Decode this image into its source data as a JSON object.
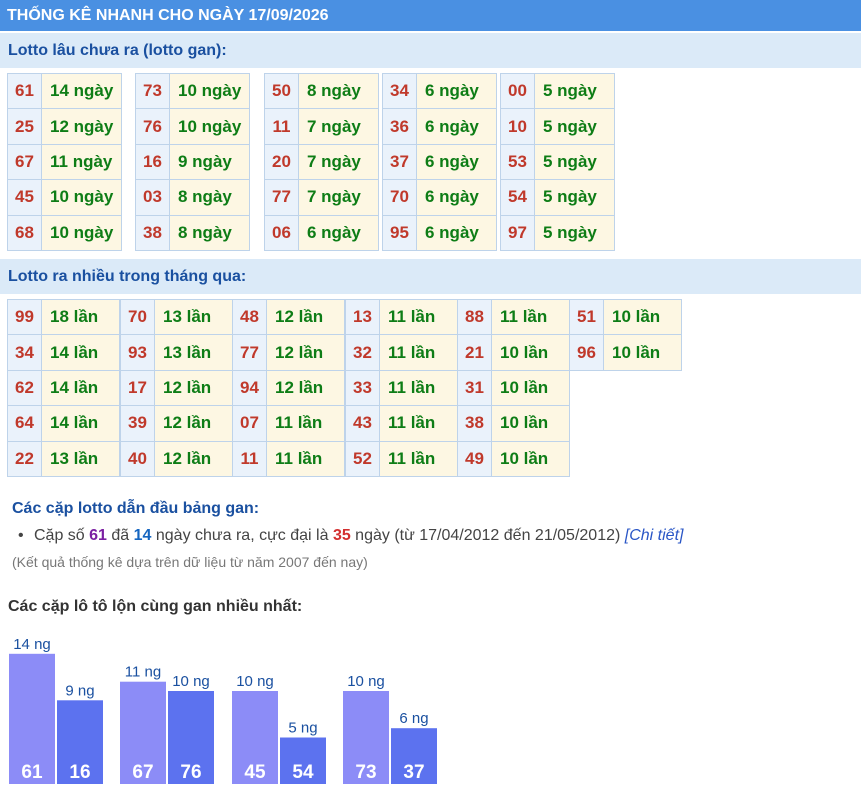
{
  "header": {
    "title": "THỐNG KÊ NHANH CHO NGÀY 17/09/2026"
  },
  "gan_section": {
    "title": "Lotto lâu chưa ra (lotto gan):",
    "columns": [
      [
        {
          "num": "61",
          "val": "14 ngày"
        },
        {
          "num": "25",
          "val": "12 ngày"
        },
        {
          "num": "67",
          "val": "11 ngày"
        },
        {
          "num": "45",
          "val": "10 ngày"
        },
        {
          "num": "68",
          "val": "10 ngày"
        }
      ],
      [
        {
          "num": "73",
          "val": "10 ngày"
        },
        {
          "num": "76",
          "val": "10 ngày"
        },
        {
          "num": "16",
          "val": "9 ngày"
        },
        {
          "num": "03",
          "val": "8 ngày"
        },
        {
          "num": "38",
          "val": "8 ngày"
        }
      ],
      [
        {
          "num": "50",
          "val": "8 ngày"
        },
        {
          "num": "11",
          "val": "7 ngày"
        },
        {
          "num": "20",
          "val": "7 ngày"
        },
        {
          "num": "77",
          "val": "7 ngày"
        },
        {
          "num": "06",
          "val": "6 ngày"
        }
      ],
      [
        {
          "num": "34",
          "val": "6 ngày"
        },
        {
          "num": "36",
          "val": "6 ngày"
        },
        {
          "num": "37",
          "val": "6 ngày"
        },
        {
          "num": "70",
          "val": "6 ngày"
        },
        {
          "num": "95",
          "val": "6 ngày"
        }
      ],
      [
        {
          "num": "00",
          "val": "5 ngày"
        },
        {
          "num": "10",
          "val": "5 ngày"
        },
        {
          "num": "53",
          "val": "5 ngày"
        },
        {
          "num": "54",
          "val": "5 ngày"
        },
        {
          "num": "97",
          "val": "5 ngày"
        }
      ]
    ]
  },
  "frequent_section": {
    "title": "Lotto ra nhiều trong tháng qua:",
    "columns": [
      [
        {
          "num": "99",
          "val": "18 lần"
        },
        {
          "num": "34",
          "val": "14 lần"
        },
        {
          "num": "62",
          "val": "14 lần"
        },
        {
          "num": "64",
          "val": "14 lần"
        },
        {
          "num": "22",
          "val": "13 lần"
        }
      ],
      [
        {
          "num": "70",
          "val": "13 lần"
        },
        {
          "num": "93",
          "val": "13 lần"
        },
        {
          "num": "17",
          "val": "12 lần"
        },
        {
          "num": "39",
          "val": "12 lần"
        },
        {
          "num": "40",
          "val": "12 lần"
        }
      ],
      [
        {
          "num": "48",
          "val": "12 lần"
        },
        {
          "num": "77",
          "val": "12 lần"
        },
        {
          "num": "94",
          "val": "12 lần"
        },
        {
          "num": "07",
          "val": "11 lần"
        },
        {
          "num": "11",
          "val": "11 lần"
        }
      ],
      [
        {
          "num": "13",
          "val": "11 lần"
        },
        {
          "num": "32",
          "val": "11 lần"
        },
        {
          "num": "33",
          "val": "11 lần"
        },
        {
          "num": "43",
          "val": "11 lần"
        },
        {
          "num": "52",
          "val": "11 lần"
        }
      ],
      [
        {
          "num": "88",
          "val": "11 lần"
        },
        {
          "num": "21",
          "val": "10 lần"
        },
        {
          "num": "31",
          "val": "10 lần"
        },
        {
          "num": "38",
          "val": "10 lần"
        },
        {
          "num": "49",
          "val": "10 lần"
        }
      ],
      [
        {
          "num": "51",
          "val": "10 lần"
        },
        {
          "num": "96",
          "val": "10 lần"
        }
      ]
    ]
  },
  "lead_section": {
    "title": "Các cặp lotto dẫn đầu bảng gan:",
    "line": {
      "bullet": "•",
      "t1": "Cặp số ",
      "pair": "61",
      "t2": " đã ",
      "days": "14",
      "t3": " ngày chưa ra, cực đại là ",
      "max": "35",
      "t4": " ngày (từ 17/04/2012 đến 21/05/2012) ",
      "link": "[Chi tiết]"
    },
    "note": "(Kết quả thống kê dựa trên dữ liệu từ năm 2007 đến nay)"
  },
  "pair_chart": {
    "title": "Các cặp lô tô lộn cùng gan nhiều nhất:",
    "unit_suffix": " ng",
    "pairs": [
      {
        "a": {
          "num": "61",
          "days": 14
        },
        "b": {
          "num": "16",
          "days": 9
        }
      },
      {
        "a": {
          "num": "67",
          "days": 11
        },
        "b": {
          "num": "76",
          "days": 10
        }
      },
      {
        "a": {
          "num": "45",
          "days": 10
        },
        "b": {
          "num": "54",
          "days": 5
        }
      },
      {
        "a": {
          "num": "73",
          "days": 10
        },
        "b": {
          "num": "37",
          "days": 6
        }
      }
    ],
    "colors": {
      "first": "#8c8cf7",
      "second": "#5c72ef",
      "label": "#1a50a0",
      "bar_text": "#ffffff"
    }
  }
}
